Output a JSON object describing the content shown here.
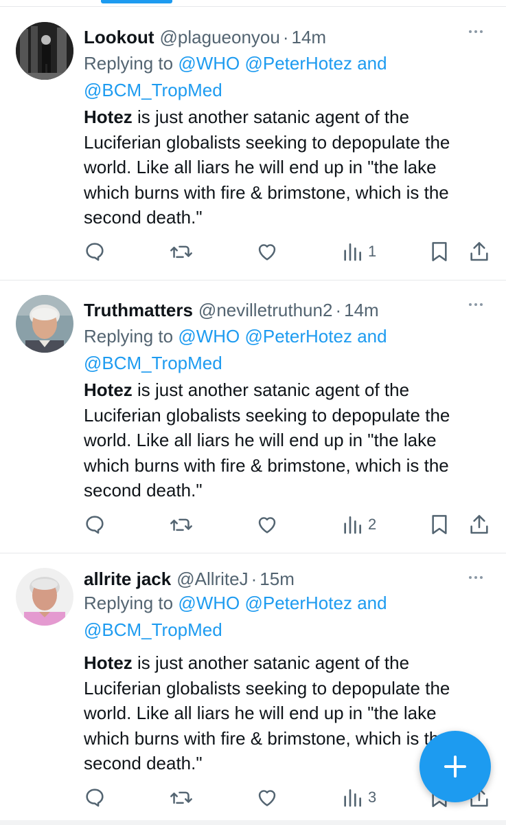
{
  "tweets": [
    {
      "name": "Lookout",
      "handle": "@plagueonyou",
      "separator": "·",
      "time": "14m",
      "reply_prefix": "Replying to",
      "mention_1": "@WHO",
      "mention_2": "@PeterHotez",
      "conjunction": "and",
      "mention_3": "@BCM_TropMed",
      "body_bold": "Hotez",
      "body_line1": " is just another satanic agent of the",
      "body_line2": "Luciferian globalists seeking to depopulate the",
      "body_line3": "world. Like all liars he will end up in \"the lake",
      "body_line4": "which burns with fire & brimstone, which is the",
      "body_line5": "second death.\"",
      "views": "1"
    },
    {
      "name": "Truthmatters",
      "handle": "@nevilletruthun2",
      "separator": "·",
      "time": "14m",
      "reply_prefix": "Replying to",
      "mention_1": "@WHO",
      "mention_2": "@PeterHotez",
      "conjunction": "and",
      "mention_3": "@BCM_TropMed",
      "body_bold": "Hotez",
      "body_line1": " is just another satanic agent of the",
      "body_line2": "Luciferian globalists seeking to depopulate the",
      "body_line3": "world. Like all liars he will end up in \"the lake",
      "body_line4": "which burns with fire & brimstone, which is the",
      "body_line5": "second death.\"",
      "views": "2"
    },
    {
      "name": "allrite jack",
      "handle": "@AllriteJ",
      "separator": "·",
      "time": "15m",
      "reply_prefix": "Replying to",
      "mention_1": "@WHO",
      "mention_2": "@PeterHotez",
      "conjunction": "and",
      "mention_3": "@BCM_TropMed",
      "body_bold": "Hotez",
      "body_line1": " is just another satanic agent of the",
      "body_line2": "Luciferian globalists seeking to depopulate the",
      "body_line3": "world. Like all liars he will end up in \"the lake",
      "body_line4": "which burns with fire & brimstone, which is the",
      "body_line5": "second death.\"",
      "views": "3"
    }
  ],
  "icons": {
    "reply": "reply-icon",
    "retweet": "retweet-icon",
    "like": "heart-icon",
    "views": "analytics-icon",
    "bookmark": "bookmark-icon",
    "share": "share-icon",
    "more": "more-icon",
    "compose": "plus-icon"
  },
  "colors": {
    "accent": "#1d9bf0",
    "text": "#0f1419",
    "muted": "#536471",
    "border": "#e6e8ea"
  }
}
